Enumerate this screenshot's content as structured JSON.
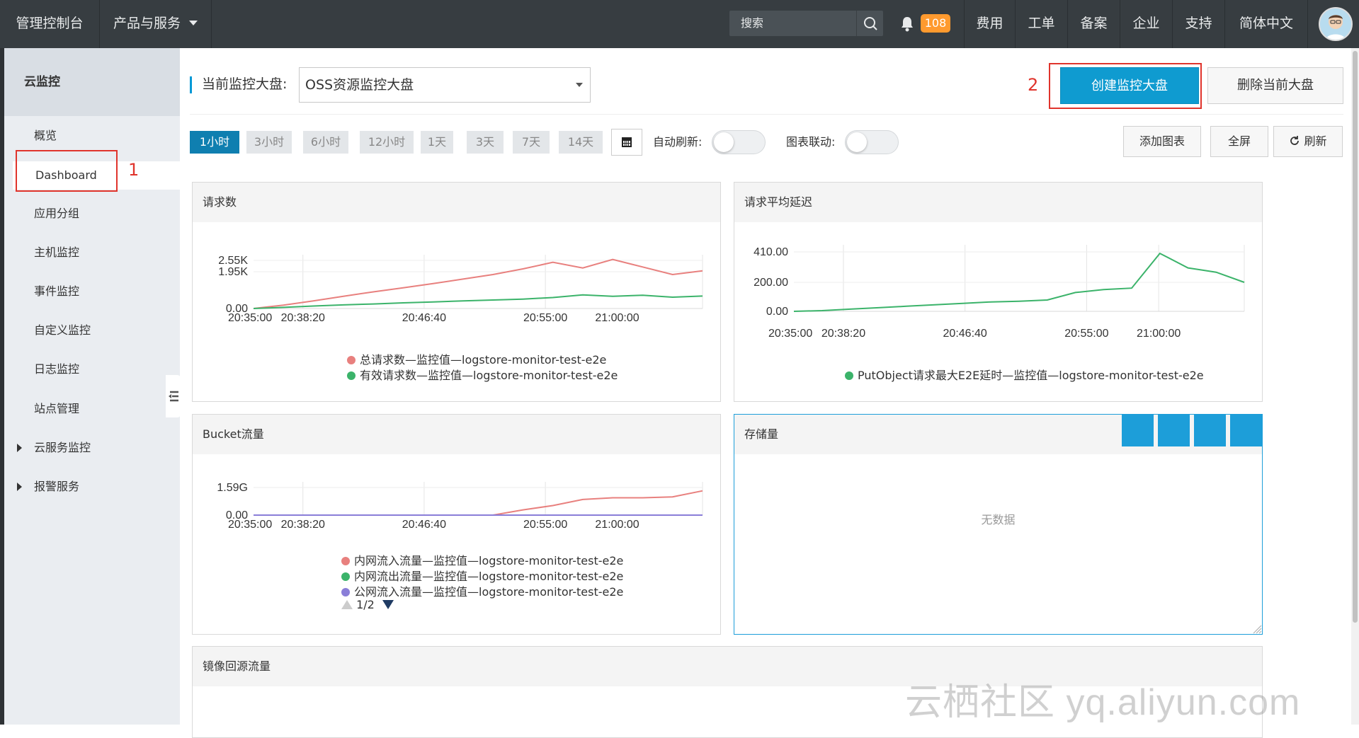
{
  "topbar": {
    "console": "管理控制台",
    "products": "产品与服务",
    "search_placeholder": "搜索",
    "notification_count": "108",
    "nav": [
      "费用",
      "工单",
      "备案",
      "企业",
      "支持",
      "简体中文"
    ]
  },
  "sidebar": {
    "title": "云监控",
    "items": [
      "概览",
      "Dashboard",
      "应用分组",
      "主机监控",
      "事件监控",
      "自定义监控",
      "日志监控",
      "站点管理",
      "云服务监控",
      "报警服务"
    ]
  },
  "annotations": {
    "step1": "1",
    "step2": "2"
  },
  "header": {
    "current_label": "当前监控大盘:",
    "dashboard_value": "OSS资源监控大盘",
    "create_button": "创建监控大盘",
    "delete_button": "删除当前大盘"
  },
  "toolbar": {
    "time_ranges": [
      "1小时",
      "3小时",
      "6小时",
      "12小时",
      "1天",
      "3天",
      "7天",
      "14天"
    ],
    "active_range": "1小时",
    "auto_refresh_label": "自动刷新:",
    "auto_refresh_on": false,
    "chart_link_label": "图表联动:",
    "chart_link_on": false,
    "add_chart": "添加图表",
    "fullscreen": "全屏",
    "refresh": "刷新"
  },
  "panels": {
    "storage_title": "存储量",
    "storage_empty": "无数据",
    "mirror_title": "镜像回源流量",
    "bucket_pagination": "1/2"
  },
  "colors": {
    "red_series": "#e8807e",
    "green_series": "#3bb36a",
    "purple_series": "#8a7ed8",
    "accent": "#0f9bd0"
  },
  "chart_data": [
    {
      "type": "line",
      "title": "请求数",
      "x_ticks": [
        "20:35:00",
        "20:38:20",
        "20:46:40",
        "20:55:00",
        "21:00:00"
      ],
      "y_ticks": [
        "0.00",
        "1.95K",
        "2.55K"
      ],
      "series": [
        {
          "name": "总请求数—监控值—logstore-monitor-test-e2e",
          "color": "#e8807e",
          "values": [
            0,
            180,
            400,
            650,
            880,
            1100,
            1320,
            1560,
            1800,
            2100,
            2450,
            2150,
            2600,
            2200,
            1800,
            2000
          ]
        },
        {
          "name": "有效请求数—监控值—logstore-monitor-test-e2e",
          "color": "#3bb36a",
          "values": [
            0,
            60,
            130,
            190,
            240,
            300,
            350,
            400,
            450,
            500,
            580,
            720,
            650,
            700,
            600,
            660
          ]
        }
      ]
    },
    {
      "type": "line",
      "title": "请求平均延迟",
      "x_ticks": [
        "20:35:00",
        "20:38:20",
        "20:46:40",
        "20:55:00",
        "21:00:00"
      ],
      "y_ticks": [
        "0.00",
        "200.00",
        "410.00"
      ],
      "series": [
        {
          "name": "PutObject请求最大E2E延时—监控值—logstore-monitor-test-e2e",
          "color": "#3bb36a",
          "values": [
            0,
            5,
            15,
            25,
            35,
            45,
            55,
            65,
            70,
            78,
            130,
            150,
            160,
            400,
            300,
            270,
            200
          ]
        }
      ]
    },
    {
      "type": "line",
      "title": "Bucket流量",
      "x_ticks": [
        "20:35:00",
        "20:38:20",
        "20:46:40",
        "20:55:00",
        "21:00:00"
      ],
      "y_ticks": [
        "0.00",
        "1.59G"
      ],
      "series": [
        {
          "name": "内网流入流量—监控值—logstore-monitor-test-e2e",
          "color": "#e8807e",
          "values": [
            0,
            0,
            0,
            0,
            0,
            0,
            0,
            0,
            0,
            0.3,
            0.55,
            0.9,
            1.0,
            1.0,
            1.05,
            1.4
          ]
        },
        {
          "name": "内网流出流量—监控值—logstore-monitor-test-e2e",
          "color": "#3bb36a",
          "values": [
            0,
            0,
            0,
            0,
            0,
            0,
            0,
            0,
            0,
            0,
            0,
            0,
            0,
            0,
            0,
            0
          ]
        },
        {
          "name": "公网流入流量—监控值—logstore-monitor-test-e2e",
          "color": "#8a7ed8",
          "values": [
            0,
            0,
            0,
            0,
            0,
            0,
            0,
            0,
            0,
            0,
            0,
            0,
            0,
            0,
            0,
            0
          ]
        }
      ]
    }
  ]
}
